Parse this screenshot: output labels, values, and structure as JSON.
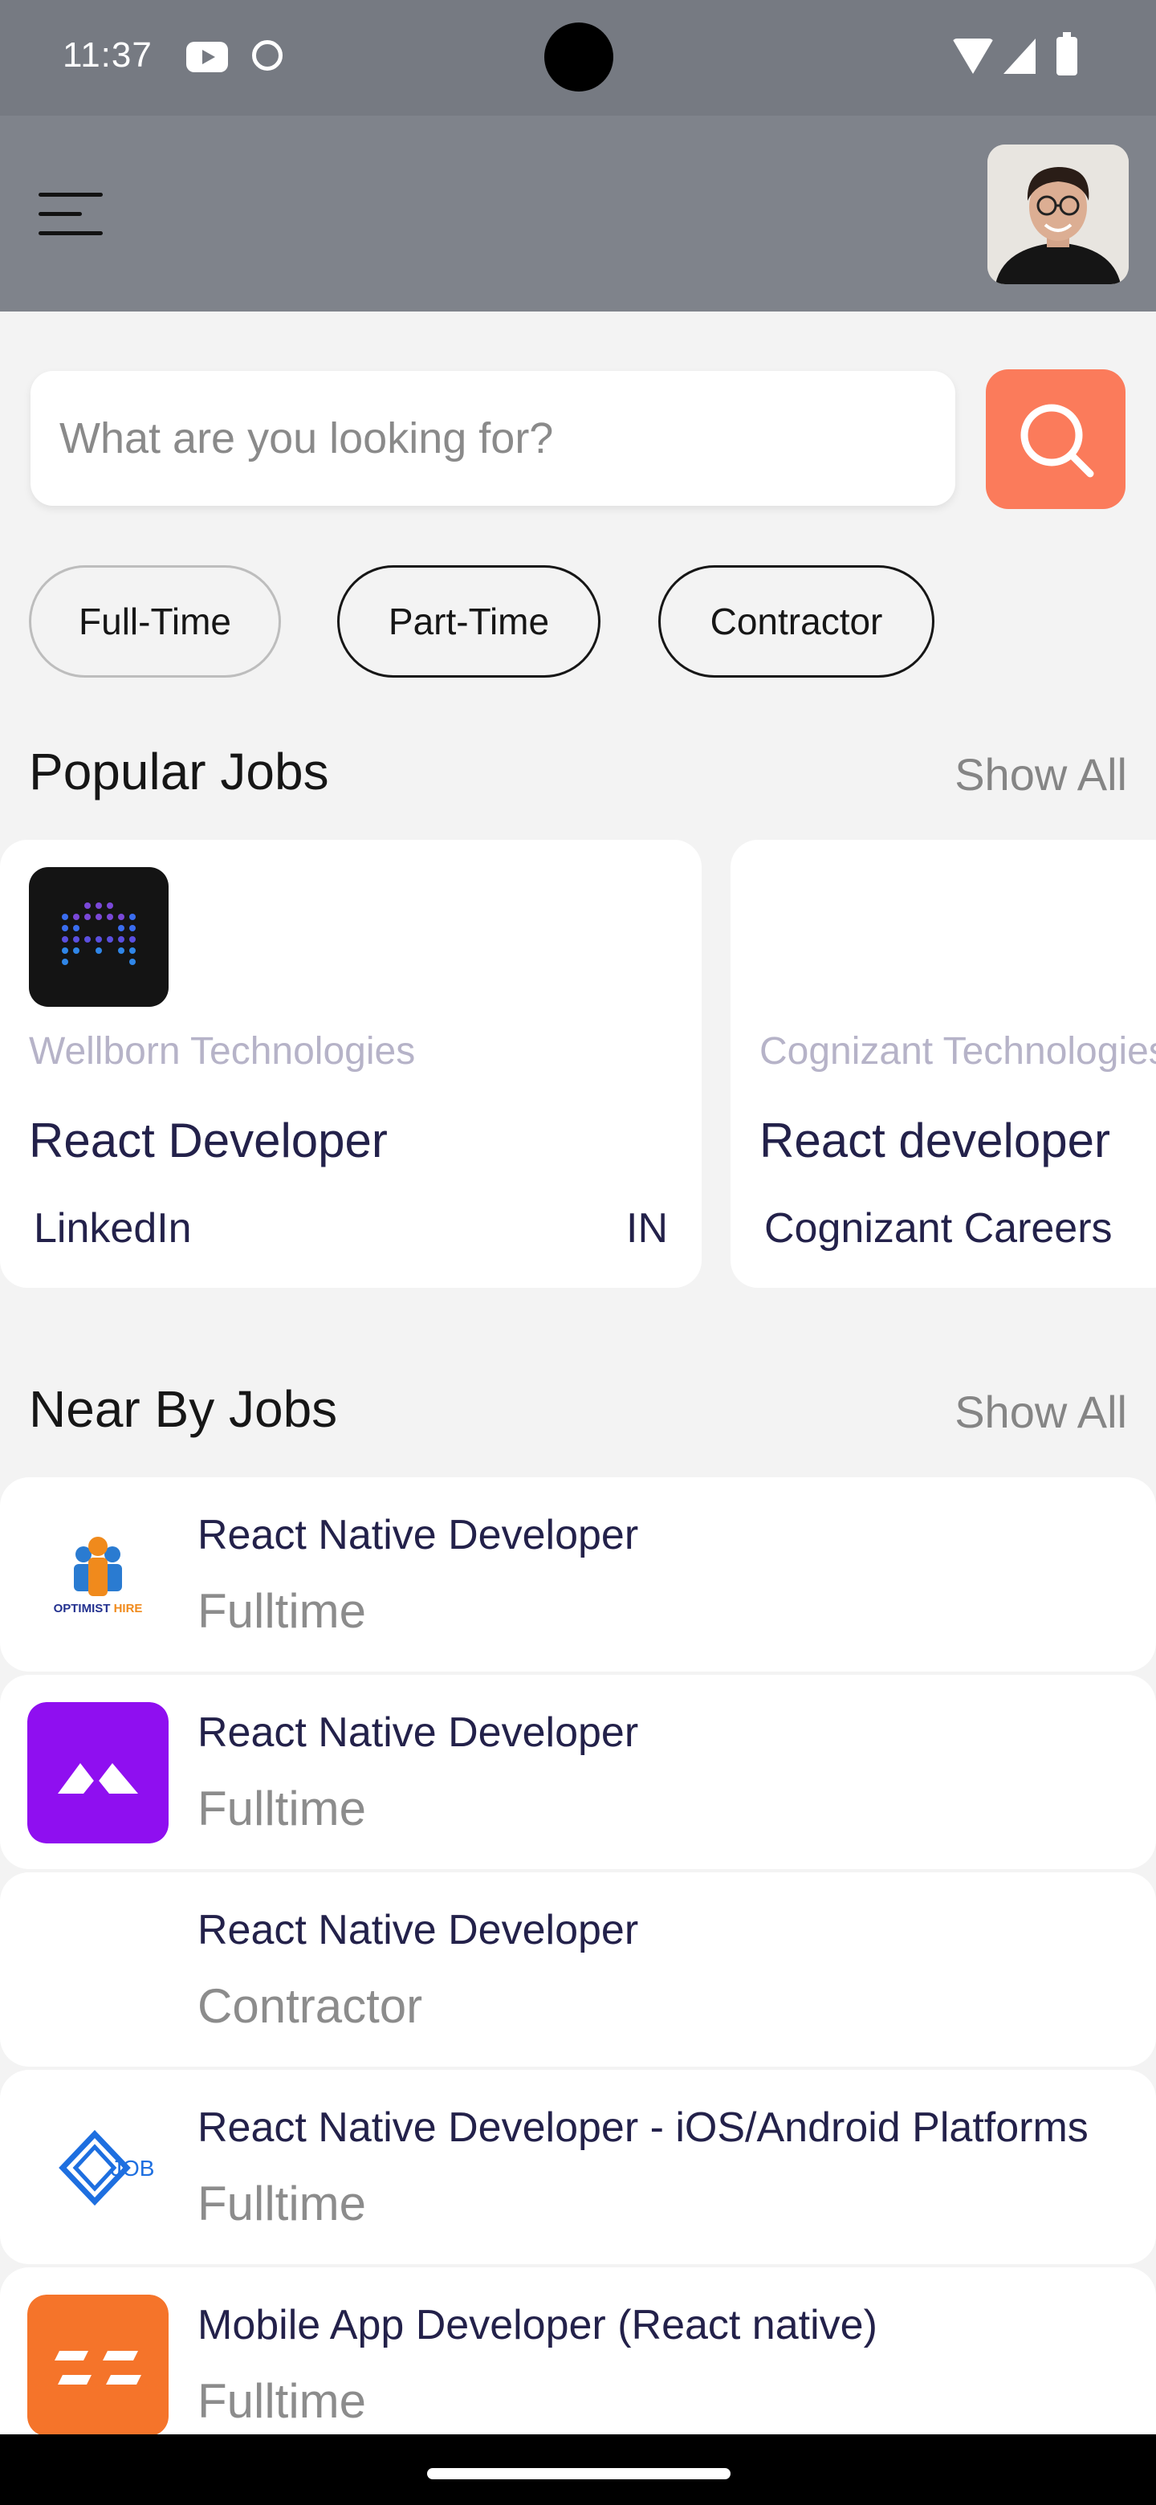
{
  "status_bar": {
    "time": "11:37"
  },
  "search": {
    "placeholder": "What are you looking for?"
  },
  "filters": [
    "Full-Time",
    "Part-Time",
    "Contractor"
  ],
  "popular": {
    "title": "Popular Jobs",
    "show_all": "Show All",
    "cards": [
      {
        "company": "Wellborn Technologies",
        "job_title": "React Developer",
        "publisher": "LinkedIn",
        "country": "IN"
      },
      {
        "company": "Cognizant Technologies",
        "job_title": "React developer",
        "publisher": "Cognizant Careers",
        "country": ""
      }
    ]
  },
  "nearby": {
    "title": "Near By Jobs",
    "show_all": "Show All",
    "jobs": [
      {
        "title": "React Native Developer",
        "type": "Fulltime",
        "logo_text": "OPTIMIST HIRE"
      },
      {
        "title": "React Native Developer",
        "type": "Fulltime",
        "logo_text": ""
      },
      {
        "title": "React Native Developer",
        "type": "Contractor",
        "logo_text": ""
      },
      {
        "title": "React Native Developer - iOS/Android Platforms",
        "type": "Fulltime",
        "logo_text": "JOB"
      },
      {
        "title": "Mobile App Developer (React native)",
        "type": "Fulltime",
        "logo_text": ""
      }
    ]
  },
  "colors": {
    "header": "#7f838b",
    "search_button": "#fb7b5b",
    "job_title": "#23214a",
    "company_muted": "#b6b3c8"
  },
  "icons": [
    "menu-icon",
    "search-icon",
    "youtube-icon",
    "wifi-icon",
    "signal-icon",
    "battery-icon"
  ]
}
